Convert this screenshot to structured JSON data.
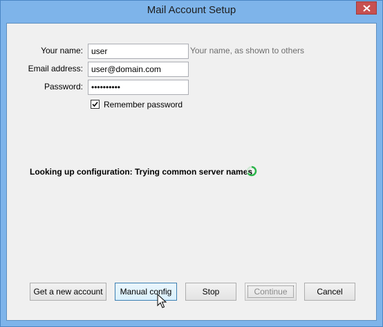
{
  "window": {
    "title": "Mail Account Setup"
  },
  "form": {
    "name_label": "Your name:",
    "name_value": "user",
    "name_hint": "Your name, as shown to others",
    "email_label": "Email address:",
    "email_value": "user@domain.com",
    "password_label": "Password:",
    "password_value": "••••••••••",
    "remember_label": "Remember password",
    "remember_checked": true
  },
  "status": {
    "text": "Looking up configuration: Trying common server names",
    "spinner_color": "#2bb44a"
  },
  "buttons": {
    "new_account": "Get a new account",
    "manual_config": "Manual config",
    "stop": "Stop",
    "continue": "Continue",
    "cancel": "Cancel"
  },
  "colors": {
    "titlebar": "#7eb4ea",
    "close_button": "#c75050",
    "dialog_bg": "#f0f0f0"
  }
}
